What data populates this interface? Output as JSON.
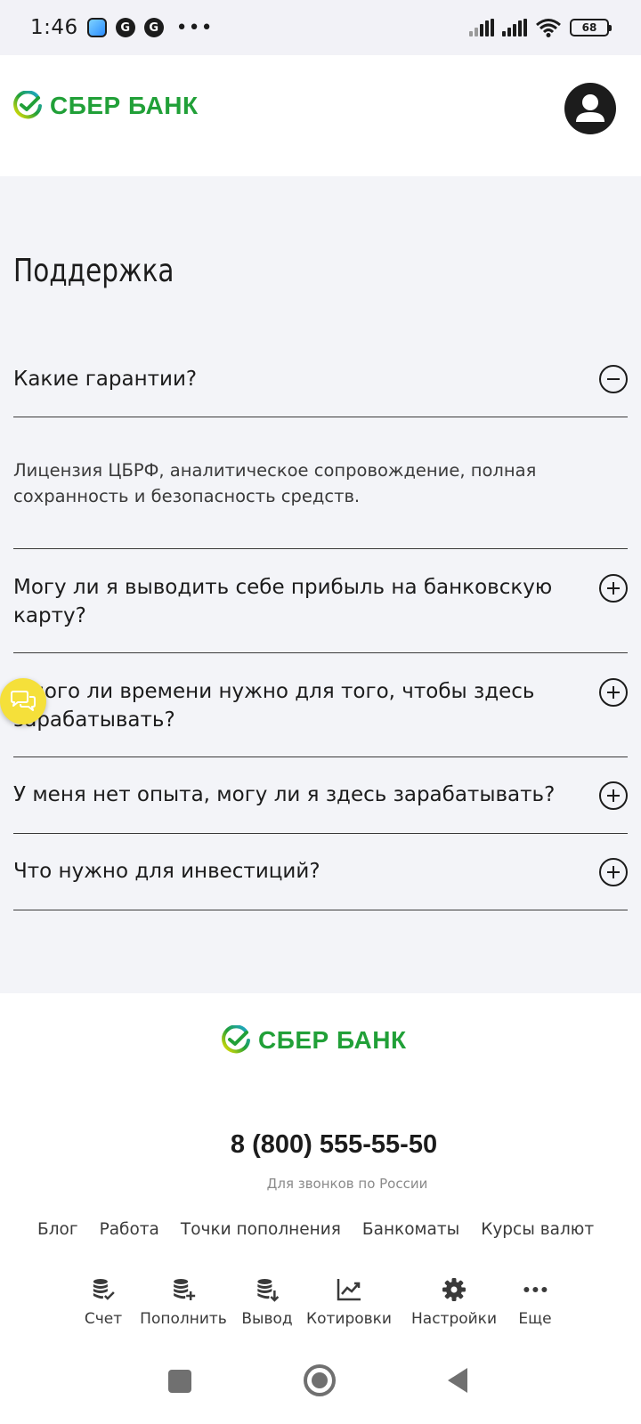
{
  "status_bar": {
    "time": "1:46",
    "g_icon_letter": "G",
    "more": "•••",
    "battery": "68"
  },
  "brand": {
    "name": "СБЕР БАНК",
    "color": "#21a038"
  },
  "support": {
    "title": "Поддержка",
    "faq": [
      {
        "question": "Какие гарантии?",
        "expanded": true,
        "answer": "Лицензия ЦБРФ, аналитическое сопровождение, полная сохранность и безопасность средств."
      },
      {
        "question": "Могу ли я выводить себе прибыль на банковскую карту?",
        "expanded": false
      },
      {
        "question": "Много ли времени нужно для того, чтобы здесь зарабатывать?",
        "expanded": false
      },
      {
        "question": "У меня нет опыта, могу ли я здесь зарабатывать?",
        "expanded": false
      },
      {
        "question": "Что нужно для инвестиций?",
        "expanded": false
      }
    ]
  },
  "footer": {
    "phone": "8 (800) 555-55-50",
    "phone_note": "Для звонков по России",
    "links": [
      "Блог",
      "Работа",
      "Точки пополнения",
      "Банкоматы",
      "Курсы валют"
    ]
  },
  "bottom_nav": [
    {
      "label": "Счет",
      "icon": "coins-check-icon"
    },
    {
      "label": "Пополнить",
      "icon": "coins-plus-icon"
    },
    {
      "label": "Вывод",
      "icon": "coins-download-icon"
    },
    {
      "label": "Котировки",
      "icon": "chart-line-icon"
    },
    {
      "label": "Настройки",
      "icon": "gear-icon"
    },
    {
      "label": "Еще",
      "icon": "more-dots-icon"
    }
  ],
  "colors": {
    "accent_green": "#21a038",
    "section_bg": "#f3f4f8",
    "chat_bubble": "#f5e03a"
  }
}
